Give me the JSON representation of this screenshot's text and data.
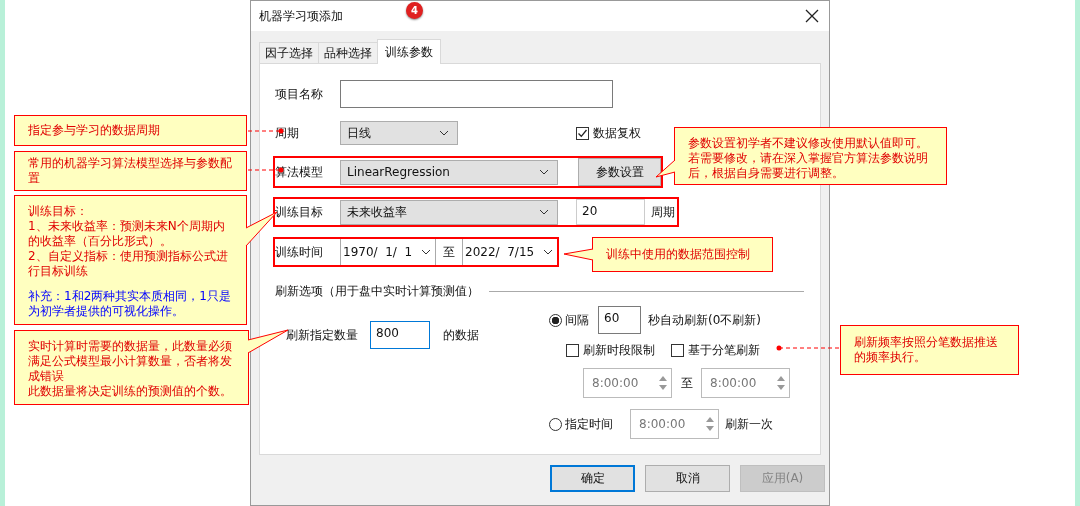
{
  "window": {
    "title": "机器学习项添加"
  },
  "step_badge": "4",
  "tabs": [
    {
      "label": "因子选择",
      "selected": false
    },
    {
      "label": "品种选择",
      "selected": false
    },
    {
      "label": "训练参数",
      "selected": true
    }
  ],
  "form": {
    "project_name": {
      "label": "项目名称"
    },
    "period": {
      "label": "周期",
      "value": "日线"
    },
    "adjust": {
      "label": "数据复权",
      "checked": true
    },
    "model": {
      "label": "算法模型",
      "value": "LinearRegression",
      "button": "参数设置"
    },
    "target": {
      "label": "训练目标",
      "value": "未来收益率",
      "count": "20",
      "unit": "周期"
    },
    "time": {
      "label": "训练时间",
      "from": "1970/  1/  1",
      "to_label": "至",
      "to": "2022/  7/15"
    }
  },
  "refresh": {
    "title": "刷新选项（用于盘中实时计算预测值）",
    "count_label": "刷新指定数量",
    "count": "800",
    "count_suffix": "的数据",
    "interval": {
      "selected": true,
      "label": "间隔",
      "value": "60",
      "suffix": "秒自动刷新(0不刷新)"
    },
    "options": [
      {
        "label": "刷新时段限制",
        "checked": false
      },
      {
        "label": "基于分笔刷新",
        "checked": false
      }
    ],
    "range": {
      "from": "8:00:00",
      "to_label": "至",
      "to": "8:00:00"
    },
    "fixed": {
      "selected": false,
      "label": "指定时间",
      "value": "8:00:00",
      "suffix": "刷新一次"
    }
  },
  "buttons": [
    {
      "label": "确定",
      "kind": "default"
    },
    {
      "label": "取消",
      "kind": "normal"
    },
    {
      "label": "应用(A)",
      "kind": "disabled"
    }
  ],
  "callouts": [
    {
      "lines": [
        "指定参与学习的数据周期"
      ]
    },
    {
      "lines": [
        "常用的机器学习算法模型选择与参数配置"
      ]
    },
    {
      "lines": [
        "训练目标：",
        "1、未来收益率：预测未来N个周期内的收益率（百分比形式）。",
        "2、自定义指标：使用预测指标公式进行目标训练"
      ],
      "supplement": "补充：1和2两种其实本质相同，1只是为初学者提供的可视化操作。"
    },
    {
      "lines": [
        "实时计算时需要的数据量，此数量必须满足公式模型最小计算数量，否者将发成错误",
        "此数据量将决定训练的预测值的个数。"
      ]
    },
    {
      "lines": [
        "参数设置初学者不建议修改使用默认值即可。",
        "若需要修改，请在深入掌握官方算法参数说明后，根据自身需要进行调整。"
      ]
    },
    {
      "lines": [
        "训练中使用的数据范围控制"
      ]
    },
    {
      "lines": [
        "刷新频率按照分笔数据推送的频率执行。"
      ]
    }
  ]
}
